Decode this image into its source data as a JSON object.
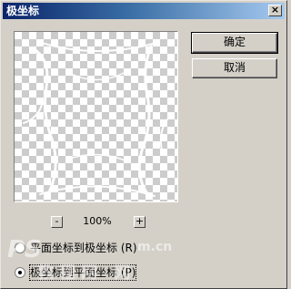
{
  "window": {
    "title": "极坐标",
    "close_glyph": "×"
  },
  "buttons": {
    "ok": "确定",
    "cancel": "取消"
  },
  "zoom": {
    "out_glyph": "-",
    "level": "100%",
    "in_glyph": "+"
  },
  "options": [
    {
      "label": "平面坐标到极坐标 (R)",
      "checked": false
    },
    {
      "label": "极坐标到平面坐标 (P)",
      "checked": true
    }
  ],
  "watermark": {
    "logo": "PS",
    "url": "m.cn",
    "site": "教程网 网"
  },
  "icons": {
    "close": "close-icon",
    "zoom_out": "minus-icon",
    "zoom_in": "plus-icon"
  }
}
